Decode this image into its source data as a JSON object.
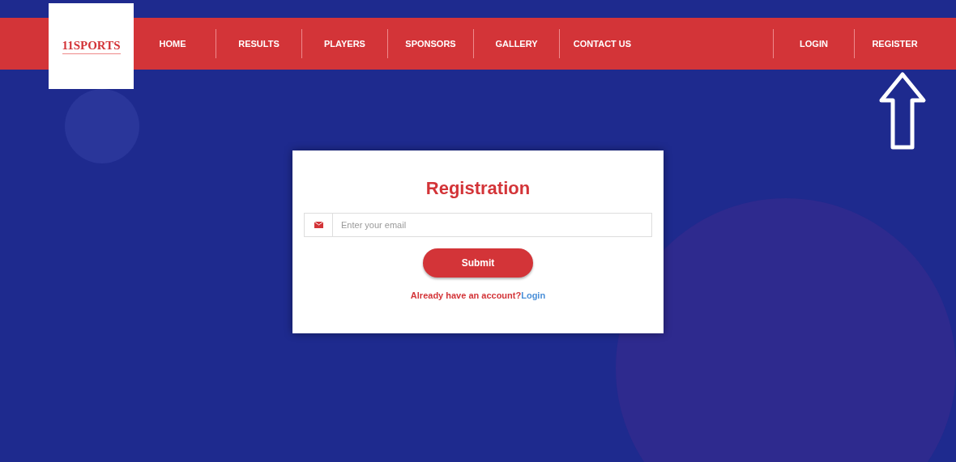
{
  "logo": {
    "text": "11SPORTS"
  },
  "nav": {
    "items": [
      "HOME",
      "RESULTS",
      "PLAYERS",
      "SPONSORS",
      "GALLERY",
      "CONTACT US"
    ],
    "account_items": [
      "LOGIN",
      "REGISTER"
    ]
  },
  "form": {
    "title": "Registration",
    "email": {
      "placeholder": "Enter your email"
    },
    "submit": "Submit",
    "footer_text": "Already have an account?",
    "footer_link": "Login"
  }
}
